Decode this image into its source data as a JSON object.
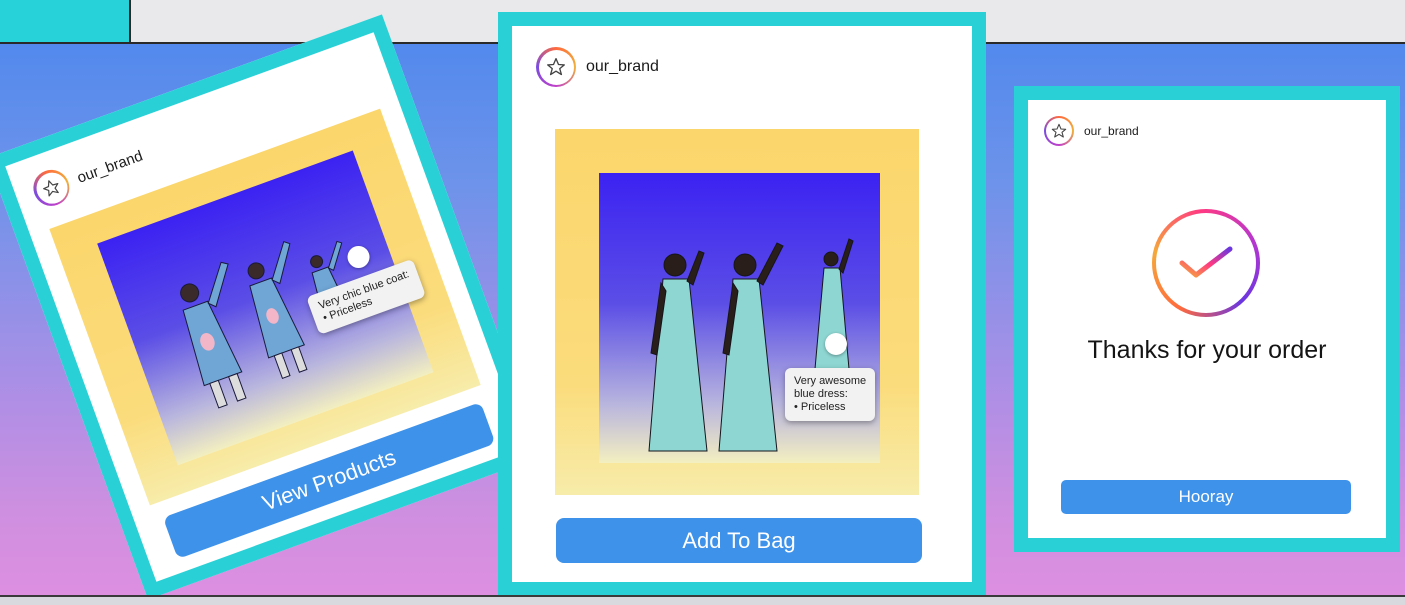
{
  "window": {
    "top_tab": "",
    "bottom_bar": ""
  },
  "colors": {
    "frame": "#29d1d6",
    "button": "#3e92ea",
    "background_top": "#4a86ee",
    "background_bottom": "#df8fe0",
    "photo_frame": "#fbd66c"
  },
  "cards": {
    "left": {
      "brand": "our_brand",
      "brand_icon": "star-icon",
      "tag": {
        "lines": [
          "Very chic blue coat:",
          "• Priceless"
        ]
      },
      "button": "View Products"
    },
    "middle": {
      "brand": "our_brand",
      "brand_icon": "star-icon",
      "tag": {
        "lines": [
          "Very awesome",
          "blue dress:",
          "• Priceless"
        ]
      },
      "button": "Add To Bag"
    },
    "right": {
      "brand": "our_brand",
      "brand_icon": "star-icon",
      "status_icon": "checkmark-icon",
      "message": "Thanks for your order",
      "button": "Hooray"
    }
  }
}
